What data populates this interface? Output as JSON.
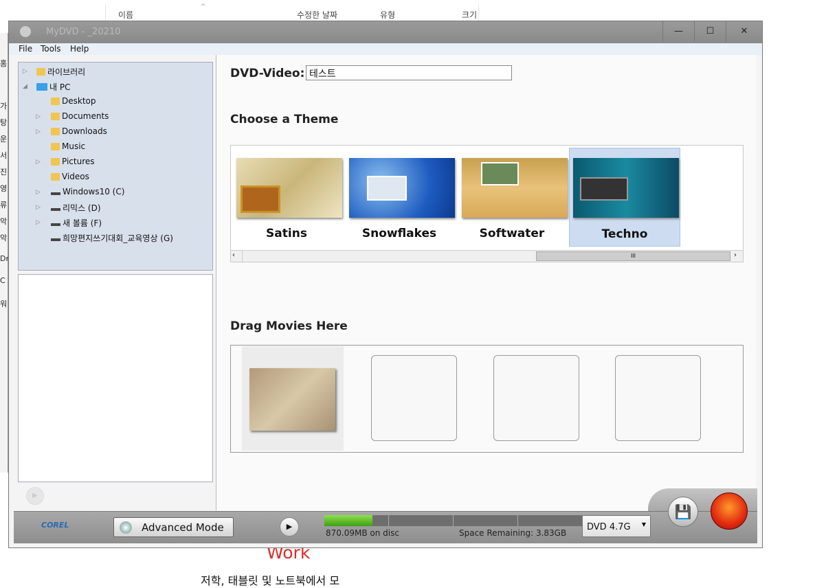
{
  "background": {
    "columns": [
      "이름",
      "수정한 날짜",
      "유형",
      "크기"
    ],
    "left_fragments": [
      "홈",
      "가",
      "탕",
      "운",
      "서",
      "진",
      "영",
      "류",
      "악",
      "악",
      "Dr",
      "C",
      "워"
    ],
    "work_label": "Work",
    "bottom_text": "저학, 태블릿 및 노트북에서 모"
  },
  "window": {
    "title": "MyDVD - _20210",
    "minimize": "—",
    "maximize": "☐",
    "close": "✕",
    "menu": [
      "File",
      "Tools",
      "Help"
    ]
  },
  "tree": [
    {
      "label": "라이브러리",
      "expander": "▷",
      "icon": "library"
    },
    {
      "label": "내 PC",
      "expander": "◢",
      "icon": "pc"
    },
    {
      "label": "Desktop",
      "icon": "folder"
    },
    {
      "label": "Documents",
      "expander": "▷",
      "icon": "folder"
    },
    {
      "label": "Downloads",
      "expander": "▷",
      "icon": "folder"
    },
    {
      "label": "Music",
      "icon": "folder"
    },
    {
      "label": "Pictures",
      "expander": "▷",
      "icon": "folder"
    },
    {
      "label": "Videos",
      "icon": "folder"
    },
    {
      "label": "Windows10 (C)",
      "expander": "▷",
      "icon": "drive"
    },
    {
      "label": "리믹스 (D)",
      "expander": "▷",
      "icon": "drive"
    },
    {
      "label": "새 볼륨 (F)",
      "expander": "▷",
      "icon": "drive"
    },
    {
      "label": "희망편지쓰기대회_교육영상 (G)",
      "icon": "drive"
    }
  ],
  "main": {
    "dvd_label": "DVD-Video:",
    "dvd_title": "테스트",
    "choose_theme": "Choose a Theme",
    "themes": [
      {
        "name": "Satins",
        "selected": false
      },
      {
        "name": "Snowflakes",
        "selected": false
      },
      {
        "name": "Softwater",
        "selected": false
      },
      {
        "name": "Techno",
        "selected": true
      }
    ],
    "drag_movies": "Drag Movies Here"
  },
  "bottom": {
    "brand": "COREL",
    "advanced_mode": "Advanced Mode",
    "used": "870.09MB on disc",
    "remaining": "Space Remaining: 3.83GB",
    "usage_fraction": 0.185,
    "disc_type": "DVD 4.7G",
    "accent": "#4fb81e"
  }
}
